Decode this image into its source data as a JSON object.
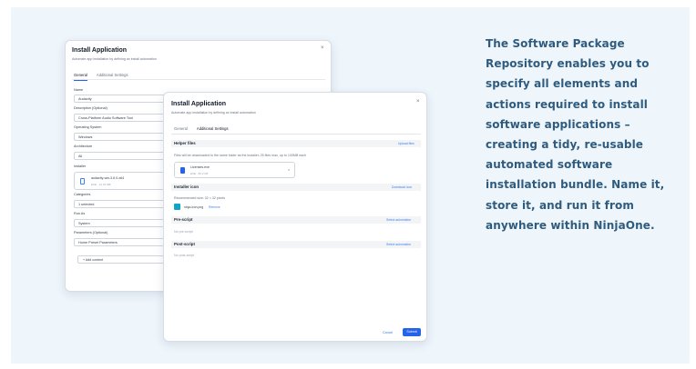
{
  "back_dialog": {
    "title": "Install Application",
    "subtitle": "Automate app installation by defining an install automation",
    "close": "×",
    "tabs": [
      "General",
      "Additional Settings"
    ],
    "fields": {
      "name_label": "Name",
      "name_value": "Audacity",
      "description_label": "Description (Optional)",
      "description_value": "Cross-Platform Audio Software Tool",
      "os_label": "Operating System",
      "os_value": "Windows",
      "arch_label": "Architecture",
      "arch_value": "All",
      "installer_label": "Installer",
      "installer_file": "audacity-win-3.6.0-x64",
      "installer_size": "EXE · 14.23 MB",
      "categories_label": "Categories",
      "categories_value": "1 selected",
      "run_as_label": "Run As",
      "run_as_value": "System",
      "params_label": "Parameters (Optional)",
      "params_value": "Home Preset Parameters",
      "add_button": "Add content"
    }
  },
  "front_dialog": {
    "title": "Install Application",
    "subtitle": "Automate app installation by defining an install automation",
    "close": "×",
    "tabs": [
      "General",
      "Additional Settings"
    ],
    "helper": {
      "title": "Helper files",
      "link": "Upload files",
      "description": "Files will be downloaded to the same folder as the installer. 25 files max, up to 100MB each",
      "file_name": "Licenses.exe",
      "file_size": "EXE · 82.2 KB"
    },
    "icon": {
      "title": "Installer icon",
      "link": "Download icon",
      "recommended": "Recommended size: 32 × 32 pixels",
      "file_name": "ninja-icon.png",
      "remove": "Remove"
    },
    "pre": {
      "title": "Pre-script",
      "link": "Select automation",
      "empty": "No pre-script"
    },
    "post": {
      "title": "Post-script",
      "link": "Select automation",
      "empty": "No post-script"
    },
    "cancel": "Cancel",
    "submit": "Submit"
  },
  "promo": {
    "text": "The Software Package Repository enables you to specify all elements and actions required to install software applications – creating a tidy, re-usable automated software installation bundle. Name it, store it, and run it from anywhere within NinjaOne."
  }
}
